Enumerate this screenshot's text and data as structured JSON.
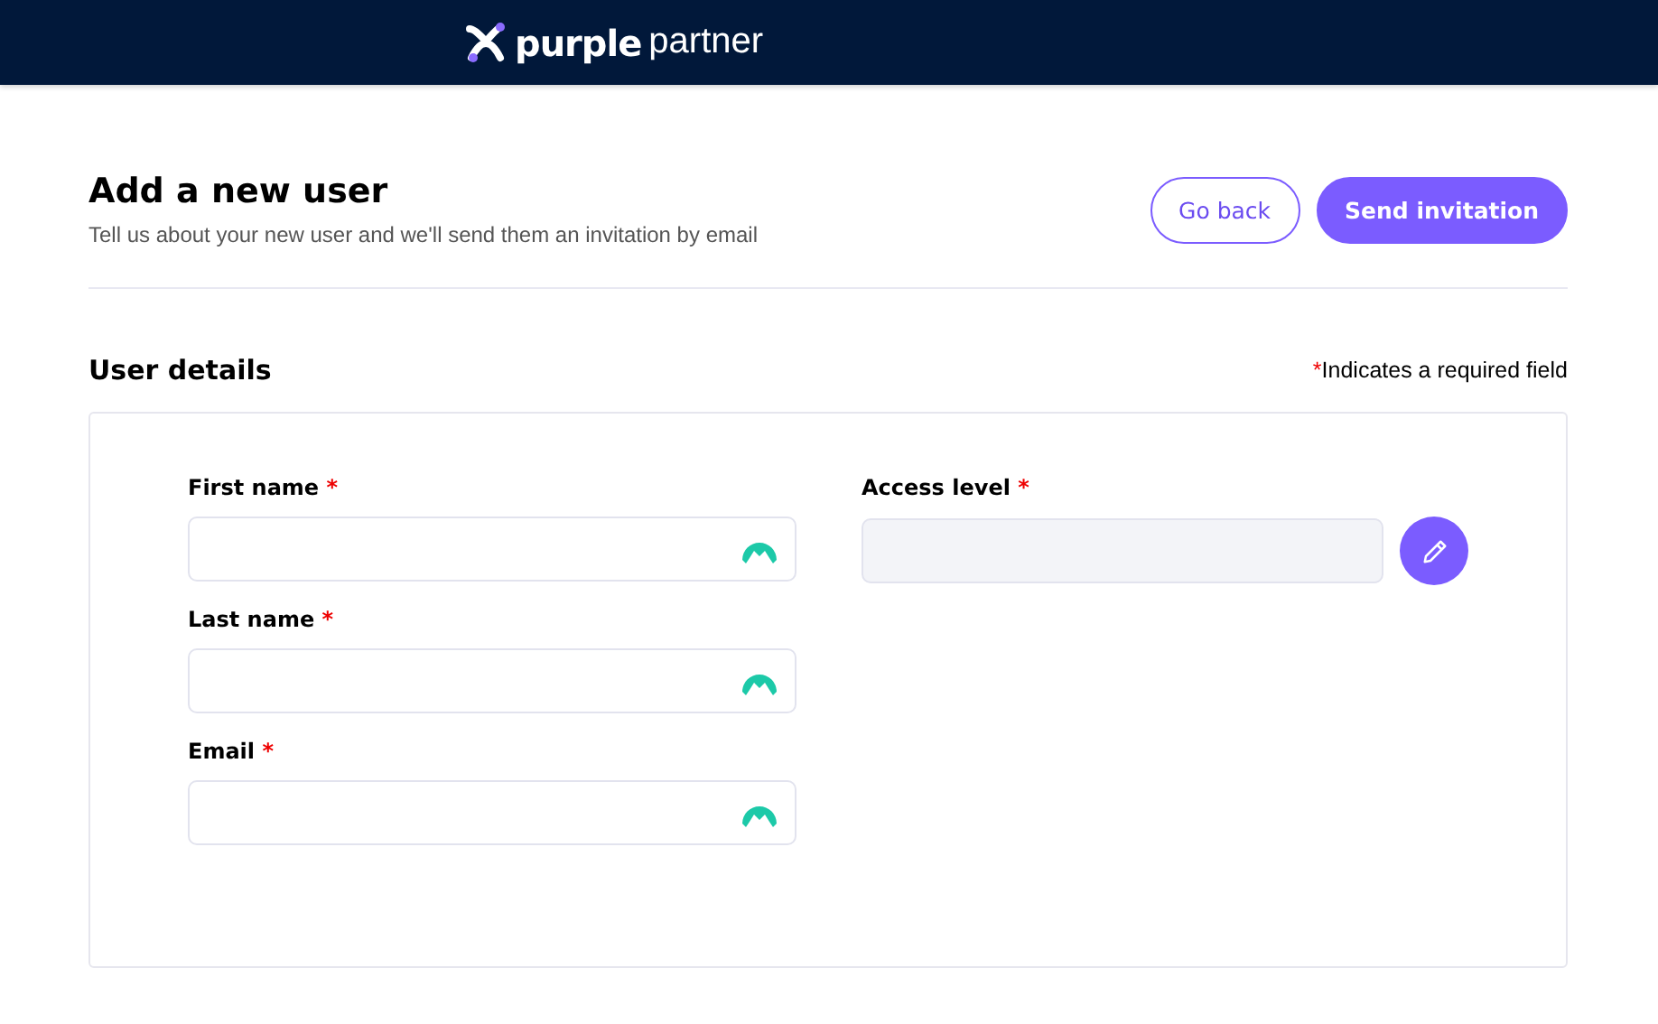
{
  "header": {
    "logo": {
      "bold": "purple",
      "light": "partner"
    }
  },
  "page": {
    "title": "Add a new user",
    "subtitle": "Tell us about your new user and we'll send them an invitation by email"
  },
  "buttons": [
    {
      "label": "Go back",
      "kind": "outline"
    },
    {
      "label": "Send invitation",
      "kind": "primary"
    }
  ],
  "section": {
    "title": "User details",
    "required_note": {
      "mark": "*",
      "text": "Indicates a required field"
    }
  },
  "columns": [
    [
      {
        "label": "First name",
        "required_mark": "*",
        "disabled": false
      },
      {
        "label": "Last name",
        "required_mark": "*",
        "disabled": false
      },
      {
        "label": "Email",
        "required_mark": "*",
        "disabled": false
      }
    ],
    [
      {
        "label": "Access level",
        "required_mark": "*",
        "disabled": true
      }
    ]
  ]
}
